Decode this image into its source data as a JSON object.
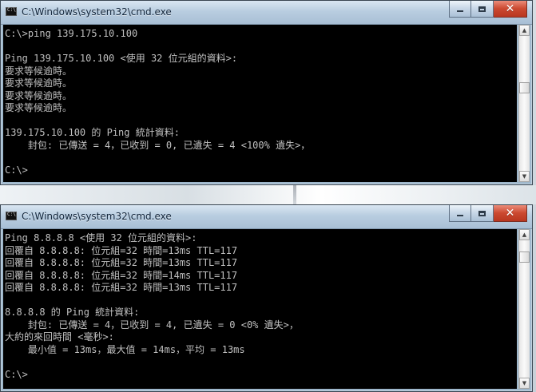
{
  "windows": [
    {
      "title": "C:\\Windows\\system32\\cmd.exe",
      "icons": {
        "app": "cmd-icon",
        "minimize": "minimize-icon",
        "maximize": "maximize-icon",
        "close": "close-icon",
        "scroll_up": "chevron-up-icon",
        "scroll_down": "chevron-down-icon"
      },
      "lines": [
        "C:\\>ping 139.175.10.100",
        "",
        "Ping 139.175.10.100 <使用 32 位元組的資料>:",
        "要求等候逾時。",
        "要求等候逾時。",
        "要求等候逾時。",
        "要求等候逾時。",
        "",
        "139.175.10.100 的 Ping 統計資料:",
        "    封包: 已傳送 = 4，已收到 = 0, 已遺失 = 4 <100% 遺失>，",
        "",
        "C:\\>"
      ]
    },
    {
      "title": "C:\\Windows\\system32\\cmd.exe",
      "icons": {
        "app": "cmd-icon",
        "minimize": "minimize-icon",
        "maximize": "maximize-icon",
        "close": "close-icon",
        "scroll_up": "chevron-up-icon",
        "scroll_down": "chevron-down-icon"
      },
      "lines": [
        "Ping 8.8.8.8 <使用 32 位元組的資料>:",
        "回覆自 8.8.8.8: 位元組=32 時間=13ms TTL=117",
        "回覆自 8.8.8.8: 位元組=32 時間=13ms TTL=117",
        "回覆自 8.8.8.8: 位元組=32 時間=14ms TTL=117",
        "回覆自 8.8.8.8: 位元組=32 時間=13ms TTL=117",
        "",
        "8.8.8.8 的 Ping 統計資料:",
        "    封包: 已傳送 = 4，已收到 = 4, 已遺失 = 0 <0% 遺失>，",
        "大約的來回時間 <毫秒>:",
        "    最小值 = 13ms，最大值 = 14ms，平均 = 13ms",
        "",
        "C:\\>"
      ]
    }
  ]
}
